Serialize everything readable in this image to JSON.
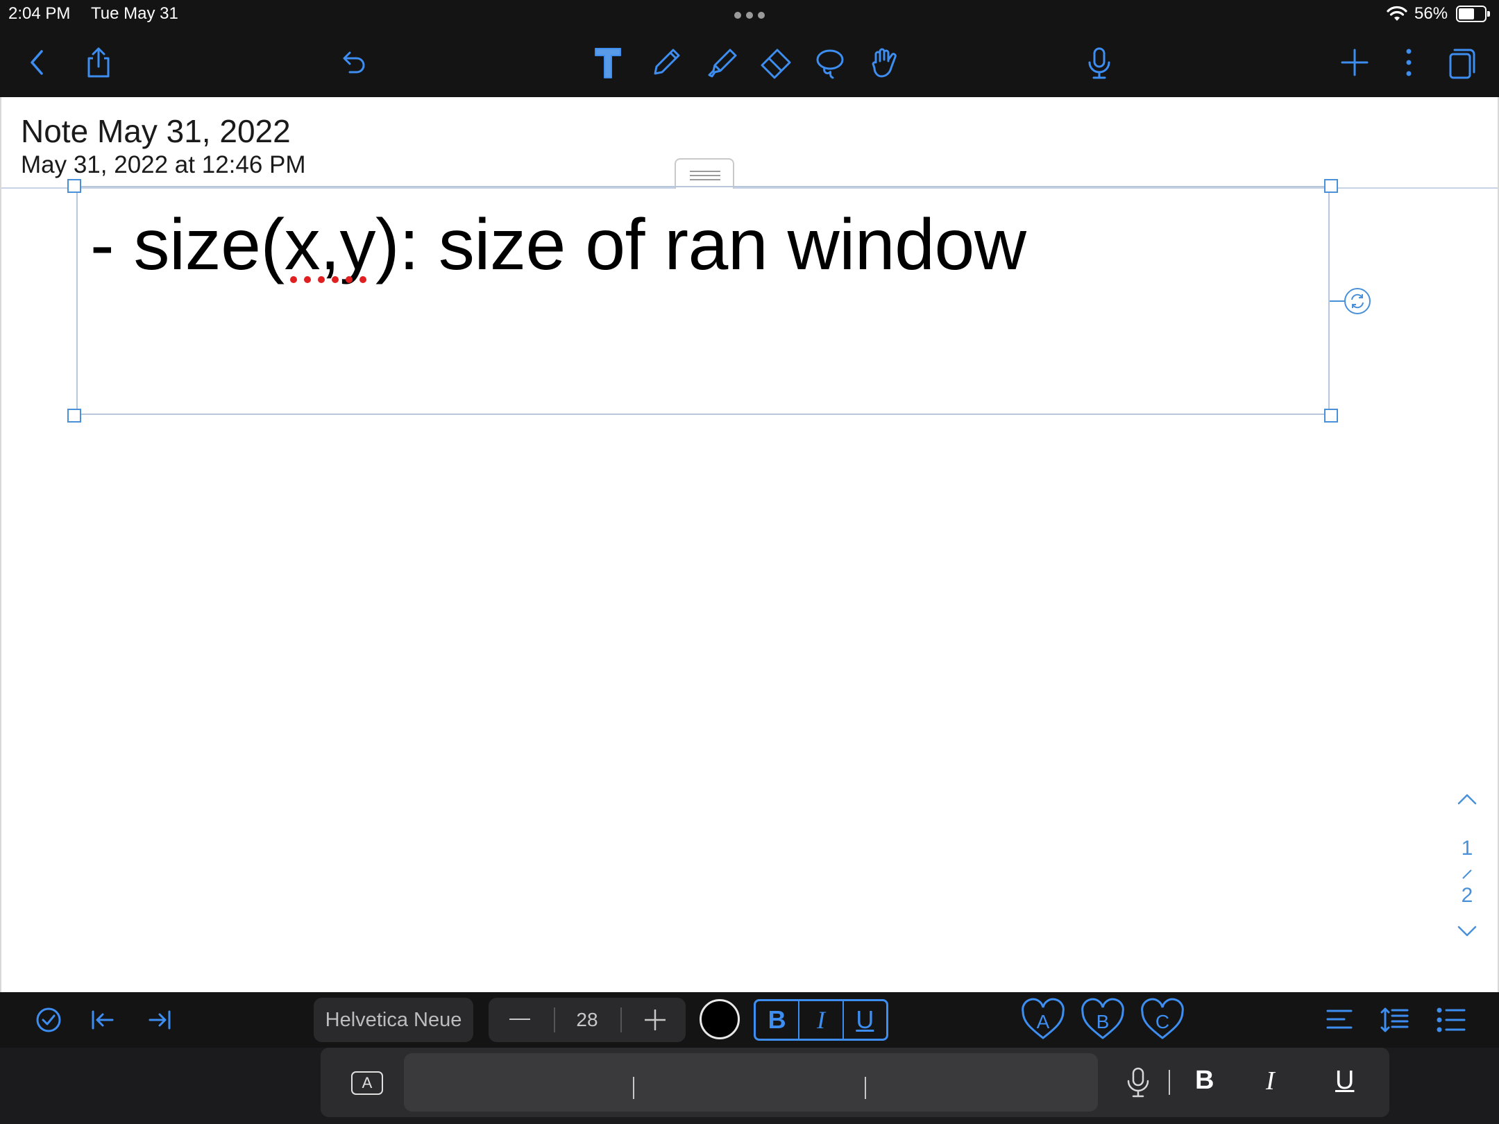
{
  "status_bar": {
    "time": "2:04 PM",
    "date": "Tue May 31",
    "battery_percent": "56%",
    "battery_level": 0.56
  },
  "toolbar": {
    "left_icons": [
      "back-chevron-icon",
      "share-icon",
      "undo-icon"
    ],
    "tools": [
      "text-tool-icon",
      "pen-tool-icon",
      "highlighter-tool-icon",
      "eraser-tool-icon",
      "lasso-tool-icon",
      "hand-tool-icon"
    ],
    "right_icons": [
      "microphone-icon",
      "add-page-icon",
      "more-options-icon",
      "page-thumbnails-icon"
    ],
    "accent_color": "#3d8ef0"
  },
  "note": {
    "title": "Note May 31, 2022",
    "created": "May 31, 2022 at 12:46 PM",
    "textbox_text": "- size(x,y): size of ran window"
  },
  "pager": {
    "current": "1",
    "total": "2"
  },
  "format_bar": {
    "font": "Helvetica Neue",
    "size": "28",
    "styles": [
      "B",
      "I",
      "U"
    ],
    "favorites": [
      "A",
      "B",
      "C"
    ],
    "text_color": "#000000"
  },
  "keyboard_bar": {
    "styles": [
      "B",
      "I",
      "U"
    ],
    "format_key_label": "A"
  }
}
